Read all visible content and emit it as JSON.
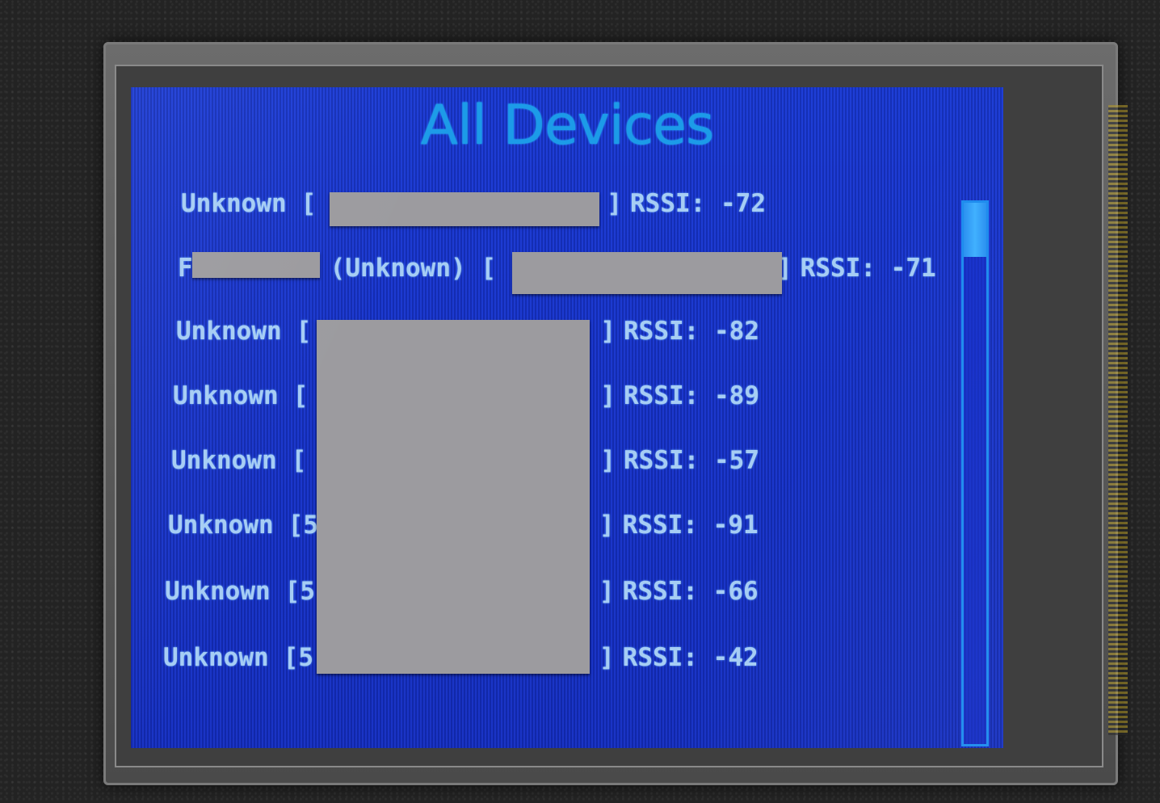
{
  "screen": {
    "title": "All Devices"
  },
  "devices": [
    {
      "name": "Unknown",
      "mac_open": "[",
      "mac_close": "]",
      "rssi_label": "RSSI:",
      "rssi": "-72"
    },
    {
      "name": "F",
      "name_suffix": "(Unknown)",
      "mac_open": "[",
      "mac_close": "]",
      "rssi_label": "RSSI:",
      "rssi": "-71"
    },
    {
      "name": "Unknown",
      "mac_open": "[",
      "mac_close": "]",
      "rssi_label": "RSSI:",
      "rssi": "-82"
    },
    {
      "name": "Unknown",
      "mac_open": "[",
      "mac_close": "]",
      "rssi_label": "RSSI:",
      "rssi": "-89"
    },
    {
      "name": "Unknown",
      "mac_open": "[",
      "mac_close": "]",
      "rssi_label": "RSSI:",
      "rssi": "-57"
    },
    {
      "name": "Unknown",
      "mac_open": "[5",
      "mac_close": "]",
      "rssi_label": "RSSI:",
      "rssi": "-91"
    },
    {
      "name": "Unknown",
      "mac_open": "[5",
      "mac_close": "]",
      "rssi_label": "RSSI:",
      "rssi": "-66"
    },
    {
      "name": "Unknown",
      "mac_open": "[5",
      "mac_close": "]",
      "rssi_label": "RSSI:",
      "rssi": "-42"
    }
  ],
  "scroll": {
    "position_fraction": 0.0,
    "visible_fraction": 0.1
  },
  "colors": {
    "screen_bg": "#1734cc",
    "title": "#1c9be8",
    "text": "#a6cdf4",
    "redaction": "#9c9b9f",
    "scrollbar": "#1d8bee"
  }
}
